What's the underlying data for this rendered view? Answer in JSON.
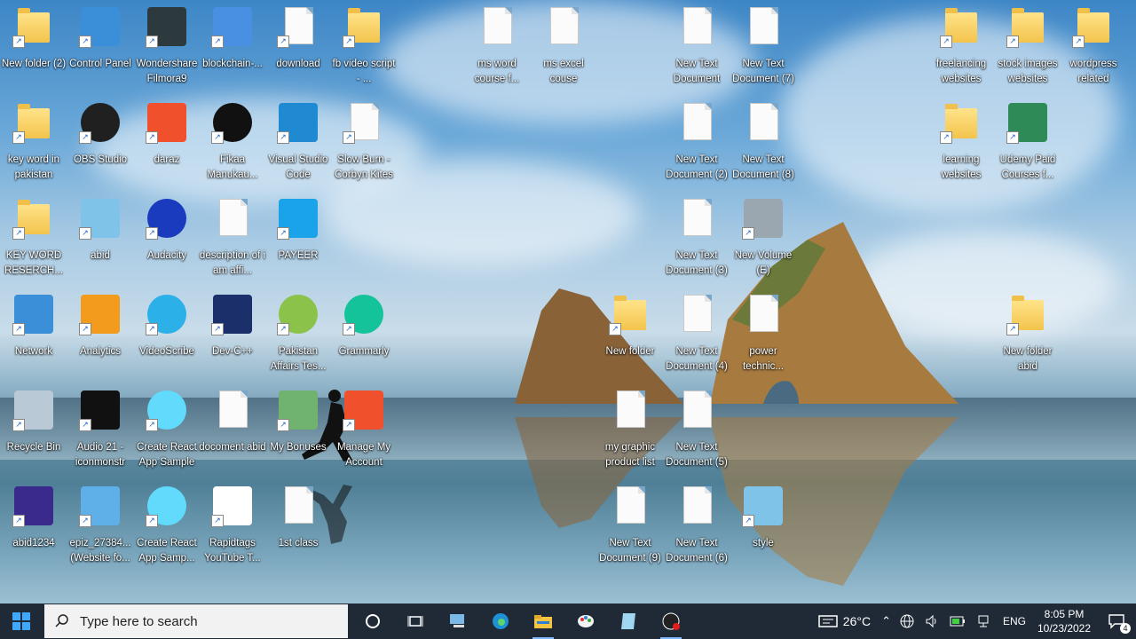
{
  "desktop": {
    "icons": [
      {
        "label": "New folder (2)",
        "icon": "folder-icon",
        "type": "folder"
      },
      {
        "label": "Control Panel",
        "icon": "control-panel-icon",
        "type": "tile",
        "color": "#3b8fd8"
      },
      {
        "label": "Wondershare Filmora9",
        "icon": "filmora-icon",
        "type": "tile",
        "color": "#2c3a3d"
      },
      {
        "label": "blockchain-...",
        "icon": "blockchain-icon",
        "type": "tile",
        "color": "#4a90e2"
      },
      {
        "label": "download",
        "icon": "arabic-text-doc-icon",
        "type": "doc"
      },
      {
        "label": "fb video script - ...",
        "icon": "folder-icon",
        "type": "folder"
      },
      {
        "label": "ms word course f...",
        "icon": "text-document-icon",
        "type": "doc"
      },
      {
        "label": "ms excel couse",
        "icon": "text-document-icon",
        "type": "doc"
      },
      {
        "label": "New Text Document",
        "icon": "text-document-icon",
        "type": "doc"
      },
      {
        "label": "New Text Document (7)",
        "icon": "text-document-icon",
        "type": "doc"
      },
      {
        "label": "freelancing websites",
        "icon": "books-folder-icon",
        "type": "folder"
      },
      {
        "label": "stock images websites",
        "icon": "books-folder-icon",
        "type": "folder"
      },
      {
        "label": "wordpress related",
        "icon": "books-folder-icon",
        "type": "folder"
      },
      {
        "label": "key word in pakistan",
        "icon": "folder-icon",
        "type": "folder"
      },
      {
        "label": "OBS Studio",
        "icon": "obs-icon",
        "type": "round",
        "color": "#202020"
      },
      {
        "label": "daraz",
        "icon": "daraz-icon",
        "type": "tile",
        "color": "#f0512c"
      },
      {
        "label": "Fikaa Manukau...",
        "icon": "play-circle-icon",
        "type": "round",
        "color": "#111111"
      },
      {
        "label": "Visual Studio Code",
        "icon": "vscode-icon",
        "type": "tile",
        "color": "#1f8ad2"
      },
      {
        "label": "Slow Burn - Corbyn Kites",
        "icon": "music-file-icon",
        "type": "doc"
      },
      {
        "label": "New Text Document (2)",
        "icon": "text-document-icon",
        "type": "doc"
      },
      {
        "label": "New Text Document (8)",
        "icon": "text-document-icon",
        "type": "doc"
      },
      {
        "label": "learning websites",
        "icon": "books-folder-icon",
        "type": "folder"
      },
      {
        "label": "Udemy Paid Courses f...",
        "icon": "aq-icon",
        "type": "tile",
        "color": "#2e8b57"
      },
      {
        "label": "KEY WORD RESERCH...",
        "icon": "folder-icon",
        "type": "folder"
      },
      {
        "label": "abid",
        "icon": "notepad-icon",
        "type": "tile",
        "color": "#7fc4e8"
      },
      {
        "label": "Audacity",
        "icon": "audacity-icon",
        "type": "round",
        "color": "#1a3bbd"
      },
      {
        "label": "description of i am affi...",
        "icon": "text-document-icon",
        "type": "doc"
      },
      {
        "label": "PAYEER",
        "icon": "payeer-icon",
        "type": "tile",
        "color": "#1aa3e8"
      },
      {
        "label": "New Text Document (3)",
        "icon": "text-document-icon",
        "type": "doc"
      },
      {
        "label": "New Volume (E)",
        "icon": "drive-icon",
        "type": "tile",
        "color": "#9aa7b0"
      },
      {
        "label": "Network",
        "icon": "network-icon",
        "type": "tile",
        "color": "#3a8fd8"
      },
      {
        "label": "Analytics",
        "icon": "analytics-icon",
        "type": "tile",
        "color": "#f29b1d"
      },
      {
        "label": "VideoScribe",
        "icon": "videoscribe-icon",
        "type": "round",
        "color": "#2bb0e8"
      },
      {
        "label": "Dev-C++",
        "icon": "devcpp-icon",
        "type": "tile",
        "color": "#1b2f6b"
      },
      {
        "label": "Pakistan Affairs Tes...",
        "icon": "g-icon",
        "type": "round",
        "color": "#8bc34a"
      },
      {
        "label": "Grammarly",
        "icon": "grammarly-icon",
        "type": "round",
        "color": "#15c39a"
      },
      {
        "label": "New folder",
        "icon": "folder-icon",
        "type": "folder"
      },
      {
        "label": "New Text Document (4)",
        "icon": "text-document-icon",
        "type": "doc"
      },
      {
        "label": "power technic...",
        "icon": "text-document-icon",
        "type": "doc"
      },
      {
        "label": "New folder abid",
        "icon": "folder-icon",
        "type": "folder"
      },
      {
        "label": "Recycle Bin",
        "icon": "recycle-bin-icon",
        "type": "tile",
        "color": "#b9c9d6"
      },
      {
        "label": "Audio 21 - iconmonstr",
        "icon": "iconmonstr-icon",
        "type": "tile",
        "color": "#111111"
      },
      {
        "label": "Create React App Sample",
        "icon": "react-icon",
        "type": "round",
        "color": "#61dafb"
      },
      {
        "label": "docoment abid",
        "icon": "text-document-icon",
        "type": "doc"
      },
      {
        "label": "My Bonuses",
        "icon": "bonuses-icon",
        "type": "tile",
        "color": "#6fb36f"
      },
      {
        "label": "Manage My Account",
        "icon": "daraz-icon",
        "type": "tile",
        "color": "#f0512c"
      },
      {
        "label": "my graphic product list",
        "icon": "text-document-icon",
        "type": "doc"
      },
      {
        "label": "New Text Document (5)",
        "icon": "text-document-icon",
        "type": "doc"
      },
      {
        "label": "abid1234",
        "icon": "firefox-file-icon",
        "type": "tile",
        "color": "#3a2a8c"
      },
      {
        "label": "epiz_27384... (Website fo...",
        "icon": "infinity-icon",
        "type": "tile",
        "color": "#5fb0e8"
      },
      {
        "label": "Create React App Samp...",
        "icon": "react-icon",
        "type": "round",
        "color": "#61dafb"
      },
      {
        "label": "Rapidtags YouTube T...",
        "icon": "r-icon",
        "type": "tile",
        "color": "#ffffff"
      },
      {
        "label": "1st class",
        "icon": "text-document-icon",
        "type": "doc"
      },
      {
        "label": "New Text Document (9)",
        "icon": "text-document-icon",
        "type": "doc"
      },
      {
        "label": "New Text Document (6)",
        "icon": "text-document-icon",
        "type": "doc"
      },
      {
        "label": "style",
        "icon": "notepad-icon",
        "type": "tile",
        "color": "#7fc4e8"
      }
    ]
  },
  "taskbar": {
    "search_placeholder": "Type here to search",
    "weather": "26°C",
    "language": "ENG",
    "time": "8:05 PM",
    "date": "10/23/2022",
    "notifications": "4"
  }
}
